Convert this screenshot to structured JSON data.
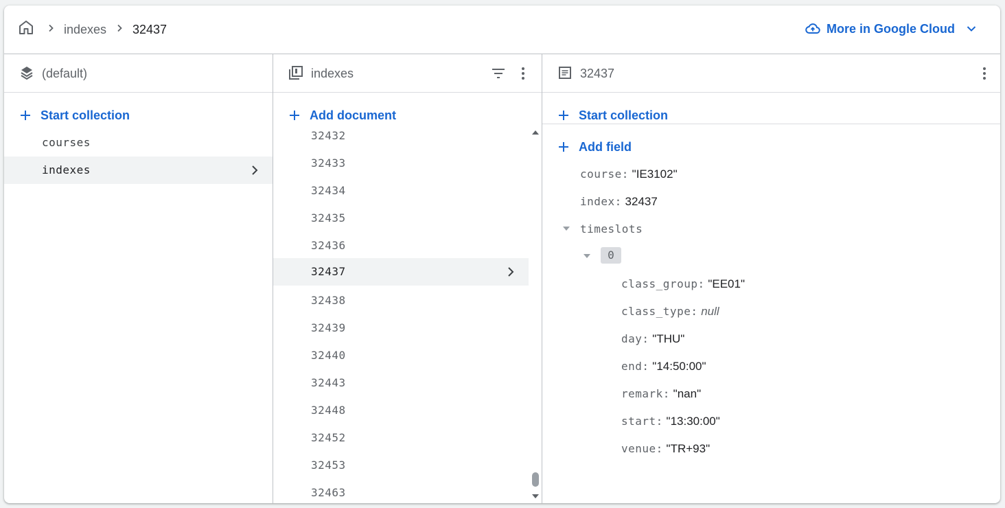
{
  "breadcrumb": {
    "items": [
      "indexes",
      "32437"
    ]
  },
  "header": {
    "gcloud_label": "More in Google Cloud"
  },
  "colors": {
    "accent": "#1967d2",
    "border": "#bdc1c6",
    "selected_bg": "#f1f3f4"
  },
  "root_panel": {
    "title": "(default)",
    "action": "Start collection",
    "collections": [
      "courses",
      "indexes"
    ],
    "selected": "indexes"
  },
  "collection_panel": {
    "title": "indexes",
    "action": "Add document",
    "documents": [
      "32432",
      "32433",
      "32434",
      "32435",
      "32436",
      "32437",
      "32438",
      "32439",
      "32440",
      "32443",
      "32448",
      "32452",
      "32453",
      "32463"
    ],
    "selected": "32437"
  },
  "document_panel": {
    "title": "32437",
    "action_collection": "Start collection",
    "action_field": "Add field",
    "fields": [
      {
        "key": "course",
        "sep": ":",
        "value": "\"IE3102\""
      },
      {
        "key": "index",
        "sep": ":",
        "value": "32437"
      }
    ],
    "array_field": {
      "key": "timeslots",
      "index": "0"
    },
    "map_fields": [
      {
        "key": "class_group",
        "sep": ":",
        "value": "\"EE01\""
      },
      {
        "key": "class_type",
        "sep": ":",
        "value": "null"
      },
      {
        "key": "day",
        "sep": ":",
        "value": "\"THU\""
      },
      {
        "key": "end",
        "sep": ":",
        "value": "\"14:50:00\""
      },
      {
        "key": "remark",
        "sep": ":",
        "value": "\"nan\""
      },
      {
        "key": "start",
        "sep": ":",
        "value": "\"13:30:00\""
      },
      {
        "key": "venue",
        "sep": ":",
        "value": "\"TR+93\""
      }
    ]
  }
}
